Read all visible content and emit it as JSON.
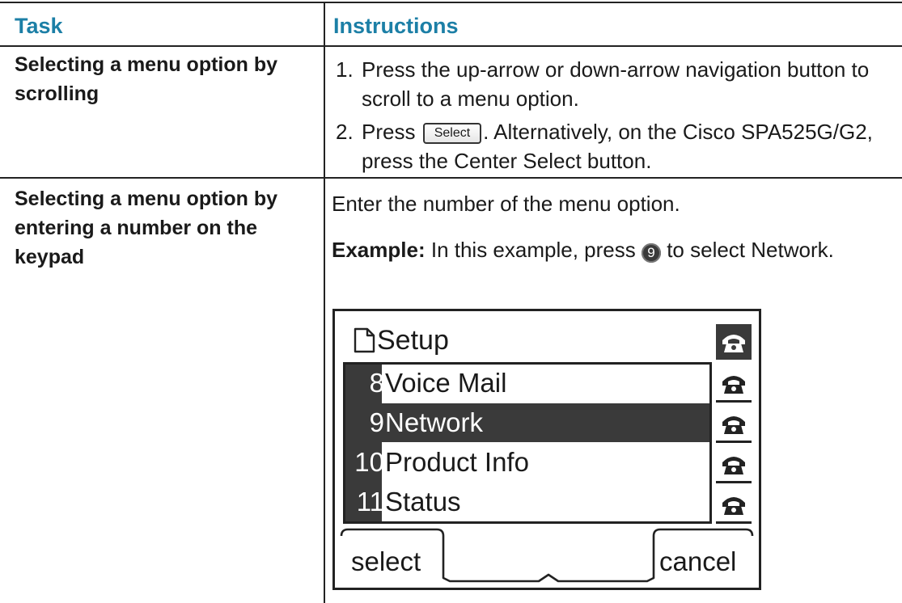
{
  "table": {
    "headers": {
      "task": "Task",
      "instructions": "Instructions"
    },
    "rows": [
      {
        "task": "Selecting a menu option by scrolling",
        "steps": [
          {
            "num": "1.",
            "text": "Press the up-arrow or down-arrow navigation button to scroll to a menu option."
          },
          {
            "num": "2.",
            "text_before": "Press",
            "softkey": "Select",
            "text_after": ". Alternatively, on the Cisco SPA525G/G2, press the Center Select button."
          }
        ]
      },
      {
        "task": "Selecting a menu option by entering a number on the keypad",
        "intro": "Enter the number of the menu option.",
        "example_label": "Example:",
        "example_before": "In this example, press",
        "example_key": "9",
        "example_after": "to select Network."
      }
    ]
  },
  "phone_screen": {
    "title": "Setup",
    "menu_items": [
      {
        "num": "8",
        "label": "Voice Mail",
        "selected": false
      },
      {
        "num": "9",
        "label": "Network",
        "selected": true
      },
      {
        "num": "10",
        "label": "Product Info",
        "selected": false
      },
      {
        "num": "11",
        "label": "Status",
        "selected": false
      }
    ],
    "softkeys": {
      "left": "select",
      "right": "cancel"
    },
    "icons": {
      "title": "document-icon",
      "line": "phone-handset-icon"
    }
  },
  "colors": {
    "header_text": "#1c7fa6",
    "highlight": "#3a3a3a"
  }
}
